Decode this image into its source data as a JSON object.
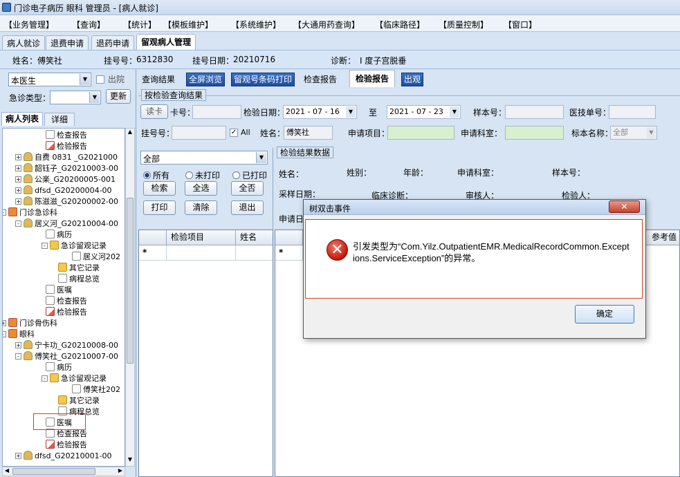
{
  "window": {
    "title": "门诊电子病历   眼科  管理员 - [病人就诊]"
  },
  "menu": [
    "【业务管理】",
    "【查询】",
    "【统计】",
    "【模板维护】",
    "【系统维护】",
    "【大通用药查询】",
    "【临床路径】",
    "【质量控制】",
    "【窗口】"
  ],
  "tabs": [
    "病人就诊",
    "退费申请",
    "退药申请",
    "留观病人管理"
  ],
  "patient": {
    "name_label": "姓名：",
    "name": "傅笑社",
    "reg_label": "挂号号：",
    "reg": "6312830",
    "regdate_label": "挂号日期：",
    "regdate": "20210716",
    "diag_label": "诊断：",
    "diag": "I 度子宫脱垂"
  },
  "left": {
    "doctor": "本医生",
    "outhosp": "出院",
    "emerg_label": "急诊类型：",
    "update_btn": "更新",
    "subtabs": [
      "病人列表",
      "详细"
    ]
  },
  "tree": [
    {
      "text": "检查报告",
      "icon": "doc"
    },
    {
      "text": "检验报告",
      "icon": "check"
    },
    {
      "text": "自费 0831 _G2021000",
      "icon": "person"
    },
    {
      "text": "韶钰子_G20210003-00",
      "icon": "person"
    },
    {
      "text": "公楽_G20200005-001",
      "icon": "person"
    },
    {
      "text": "dfsd_G20200004-00",
      "icon": "person"
    },
    {
      "text": "陈滋滋_G20200002-00",
      "icon": "person"
    },
    {
      "text": "门诊急诊科",
      "icon": "hosp"
    },
    {
      "text": "居义河_G20210004-00",
      "icon": "person"
    },
    {
      "text": "病历",
      "icon": "doc"
    },
    {
      "text": "急诊留观记录",
      "icon": "folder"
    },
    {
      "text": "居义河202",
      "icon": "doc"
    },
    {
      "text": "其它记录",
      "icon": "folder"
    },
    {
      "text": "病程总览",
      "icon": "doc"
    },
    {
      "text": "医嘱",
      "icon": "doc"
    },
    {
      "text": "检查报告",
      "icon": "doc"
    },
    {
      "text": "检验报告",
      "icon": "check"
    },
    {
      "text": "门诊骨伤科",
      "icon": "hosp"
    },
    {
      "text": "眼科",
      "icon": "hosp"
    },
    {
      "text": "宁卡功_G20210008-00",
      "icon": "person"
    },
    {
      "text": "傅笑社_G20210007-00",
      "icon": "person"
    },
    {
      "text": "病历",
      "icon": "doc"
    },
    {
      "text": "急诊留观记录",
      "icon": "folder"
    },
    {
      "text": "傅笑社202",
      "icon": "doc"
    },
    {
      "text": "其它记录",
      "icon": "folder"
    },
    {
      "text": "病程总览",
      "icon": "doc"
    },
    {
      "text": "医嘱",
      "icon": "doc"
    },
    {
      "text": "检查报告",
      "icon": "doc"
    },
    {
      "text": "检验报告",
      "icon": "check"
    },
    {
      "text": "dfsd_G20210001-00",
      "icon": "person"
    }
  ],
  "right_tabs": {
    "query_result": "查询结果",
    "fullscreen": "全屏浏览",
    "print_barcode": "留观号条码打印",
    "check_report": "检查报告",
    "lab_report": "检验报告",
    "leave": "出观"
  },
  "query": {
    "group_title": "按检验查询结果",
    "read_card": "读卡",
    "card_label": "卡号：",
    "date_label": "检验日期：",
    "date_from": "2021 - 07 - 16",
    "to": "至",
    "date_to": "2021 - 07 - 23",
    "sample_label": "样本号：",
    "tech_label": "医技单号：",
    "reg_label": "挂号号：",
    "all_label": "All",
    "name_label": "姓名：",
    "name_value": "傅笑社",
    "item_label": "申请项目：",
    "dept_label": "申请科室：",
    "specimen_label": "标本名称：",
    "specimen_value": "全部"
  },
  "left_ctrl": {
    "filter": "全部",
    "radio_all": "所有",
    "radio_unprinted": "未打印",
    "radio_printed": "已打印",
    "search": "检索",
    "select_all": "全选",
    "select_none": "全否",
    "print": "打印",
    "clear": "清除",
    "exit": "退出"
  },
  "grid_left": {
    "col1": "检验项目",
    "col2": "姓名"
  },
  "result": {
    "group_title": "检验结果数据",
    "name": "姓名：",
    "sex": "姓别：",
    "age": "年龄：",
    "dept": "申请科室：",
    "sample": "样本号：",
    "collect_date": "采样日期：",
    "clinic_diag": "临床诊断：",
    "reviewer": "审核人：",
    "tester": "检验人：",
    "apply_date": "申请日",
    "ref_col": "参考值"
  },
  "dialog": {
    "title": "树双击事件",
    "close": "✕",
    "message": "引发类型为“Com.Yilz.OutpatientEMR.MedicalRecordCommon.Exceptions.ServiceException”的异常。",
    "ok": "确定"
  }
}
